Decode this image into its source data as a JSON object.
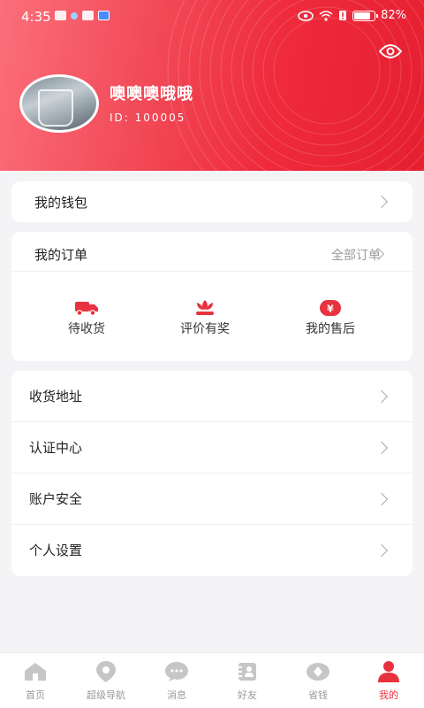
{
  "status_bar": {
    "time": "4:35",
    "battery": "82%",
    "battery_level": 0.82
  },
  "profile": {
    "name": "噢噢噢哦哦",
    "id_text": "ID: 100005"
  },
  "wallet": {
    "label": "我的钱包"
  },
  "orders": {
    "title": "我的订单",
    "all_label": "全部订单",
    "items": [
      {
        "label": "待收货",
        "icon": "truck-icon"
      },
      {
        "label": "评价有奖",
        "icon": "flower-icon"
      },
      {
        "label": "我的售后",
        "icon": "yuan-icon"
      }
    ]
  },
  "menu": [
    {
      "label": "收货地址"
    },
    {
      "label": "认证中心"
    },
    {
      "label": "账户安全"
    },
    {
      "label": "个人设置"
    }
  ],
  "tabs": [
    {
      "label": "首页",
      "icon": "home-icon"
    },
    {
      "label": "超级导航",
      "icon": "location-pin-icon"
    },
    {
      "label": "消息",
      "icon": "chat-bubble-icon"
    },
    {
      "label": "好友",
      "icon": "contacts-icon"
    },
    {
      "label": "省钱",
      "icon": "coin-icon"
    },
    {
      "label": "我的",
      "icon": "user-icon"
    }
  ],
  "active_tab": "我的",
  "colors": {
    "accent": "#e8323f",
    "header_start": "#fb6f7a",
    "header_end": "#e51f30",
    "icon_grey": "#c6c6c6"
  }
}
